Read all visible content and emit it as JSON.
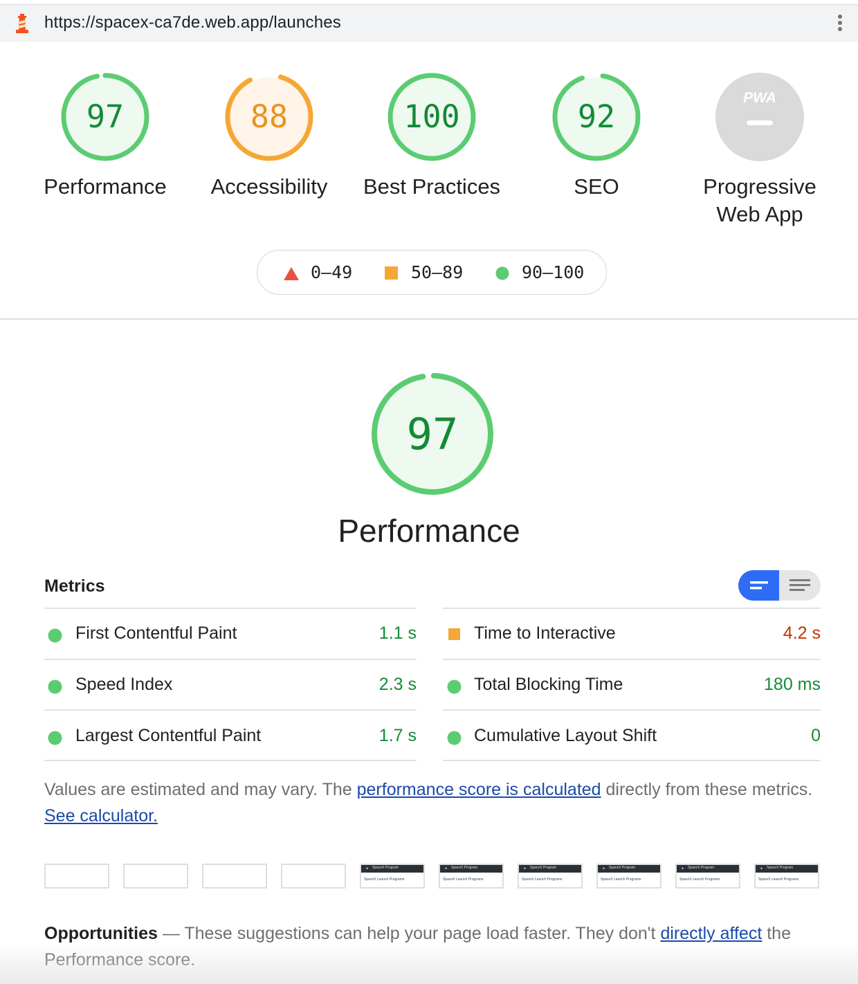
{
  "browser": {
    "url": "https://spacex-ca7de.web.app/launches",
    "icons": {
      "site": "lighthouse-icon",
      "menu": "more-vert-icon"
    }
  },
  "categories": [
    {
      "label": "Performance",
      "score": "97",
      "rating": "pass",
      "fraction": 0.97
    },
    {
      "label": "Accessibility",
      "score": "88",
      "rating": "average",
      "fraction": 0.88
    },
    {
      "label": "Best Practices",
      "score": "100",
      "rating": "pass",
      "fraction": 1.0
    },
    {
      "label": "SEO",
      "score": "92",
      "rating": "pass",
      "fraction": 0.92
    },
    {
      "label_line1": "Progressive",
      "label_line2": "Web App",
      "badge": "PWA",
      "rating": "na"
    }
  ],
  "legend": [
    {
      "range": "0–49",
      "shape": "triangle",
      "color": "#e8513f"
    },
    {
      "range": "50–89",
      "shape": "square",
      "color": "#f5a735"
    },
    {
      "range": "90–100",
      "shape": "circle",
      "color": "#5ccc72"
    }
  ],
  "performance": {
    "score": "97",
    "title": "Performance",
    "fraction": 0.97
  },
  "metrics": {
    "title": "Metrics",
    "items": [
      {
        "name": "First Contentful Paint",
        "value": "1.1 s",
        "rating": "pass"
      },
      {
        "name": "Time to Interactive",
        "value": "4.2 s",
        "rating": "average"
      },
      {
        "name": "Speed Index",
        "value": "2.3 s",
        "rating": "pass"
      },
      {
        "name": "Total Blocking Time",
        "value": "180 ms",
        "rating": "pass"
      },
      {
        "name": "Largest Contentful Paint",
        "value": "1.7 s",
        "rating": "pass"
      },
      {
        "name": "Cumulative Layout Shift",
        "value": "0",
        "rating": "pass"
      }
    ],
    "toggle_icons": [
      "view-summary-icon",
      "view-list-icon"
    ]
  },
  "note": {
    "before": "Values are estimated and may vary. The ",
    "link1": "performance score is calculated",
    "middle": " directly from these metrics. ",
    "link2": "See calculator."
  },
  "filmstrip": {
    "frames": [
      {
        "loaded": false
      },
      {
        "loaded": false
      },
      {
        "loaded": false
      },
      {
        "loaded": false
      },
      {
        "loaded": true
      },
      {
        "loaded": true
      },
      {
        "loaded": true
      },
      {
        "loaded": true
      },
      {
        "loaded": true
      },
      {
        "loaded": true
      }
    ],
    "frame_header": "SpaceX Program",
    "frame_body": "SpaceX Launch Programs"
  },
  "opportunities": {
    "title": "Opportunities",
    "dash": " — ",
    "text": "These suggestions can help your page load faster. They don't ",
    "link": "directly affect",
    "after": " the Performance score."
  },
  "colors": {
    "pass": "#5ccc72",
    "pass_text": "#138a36",
    "pass_fill": "#eef9f0",
    "average": "#f5a735",
    "average_text": "#c33300",
    "average_fill": "#fff4e7",
    "na": "#dadada"
  }
}
